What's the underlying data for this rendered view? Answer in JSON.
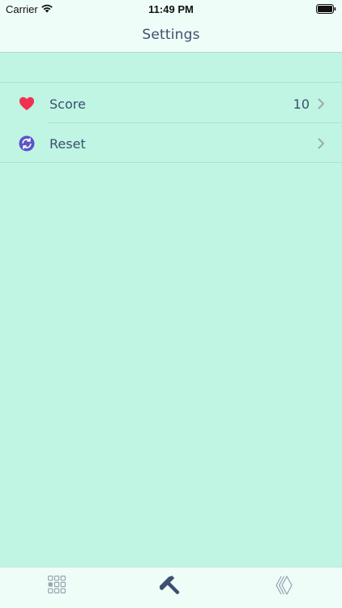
{
  "status_bar": {
    "carrier": "Carrier",
    "time": "11:49 PM"
  },
  "nav": {
    "title": "Settings"
  },
  "settings": {
    "rows": [
      {
        "label": "Score",
        "value": "10",
        "icon": "heart-icon",
        "icon_color": "#f0314f"
      },
      {
        "label": "Reset",
        "value": "",
        "icon": "refresh-icon",
        "icon_color": "#5a55c8"
      }
    ]
  },
  "tab_bar": {
    "tabs": [
      {
        "icon": "grid-icon",
        "selected": false
      },
      {
        "icon": "hammer-icon",
        "selected": true
      },
      {
        "icon": "diamond-layers-icon",
        "selected": false
      }
    ]
  },
  "colors": {
    "background": "#bff5e2",
    "bar_background": "#effdf8",
    "text": "#3e4f70",
    "tab_inactive": "#9aa4b2",
    "tab_active": "#3e4f70"
  }
}
